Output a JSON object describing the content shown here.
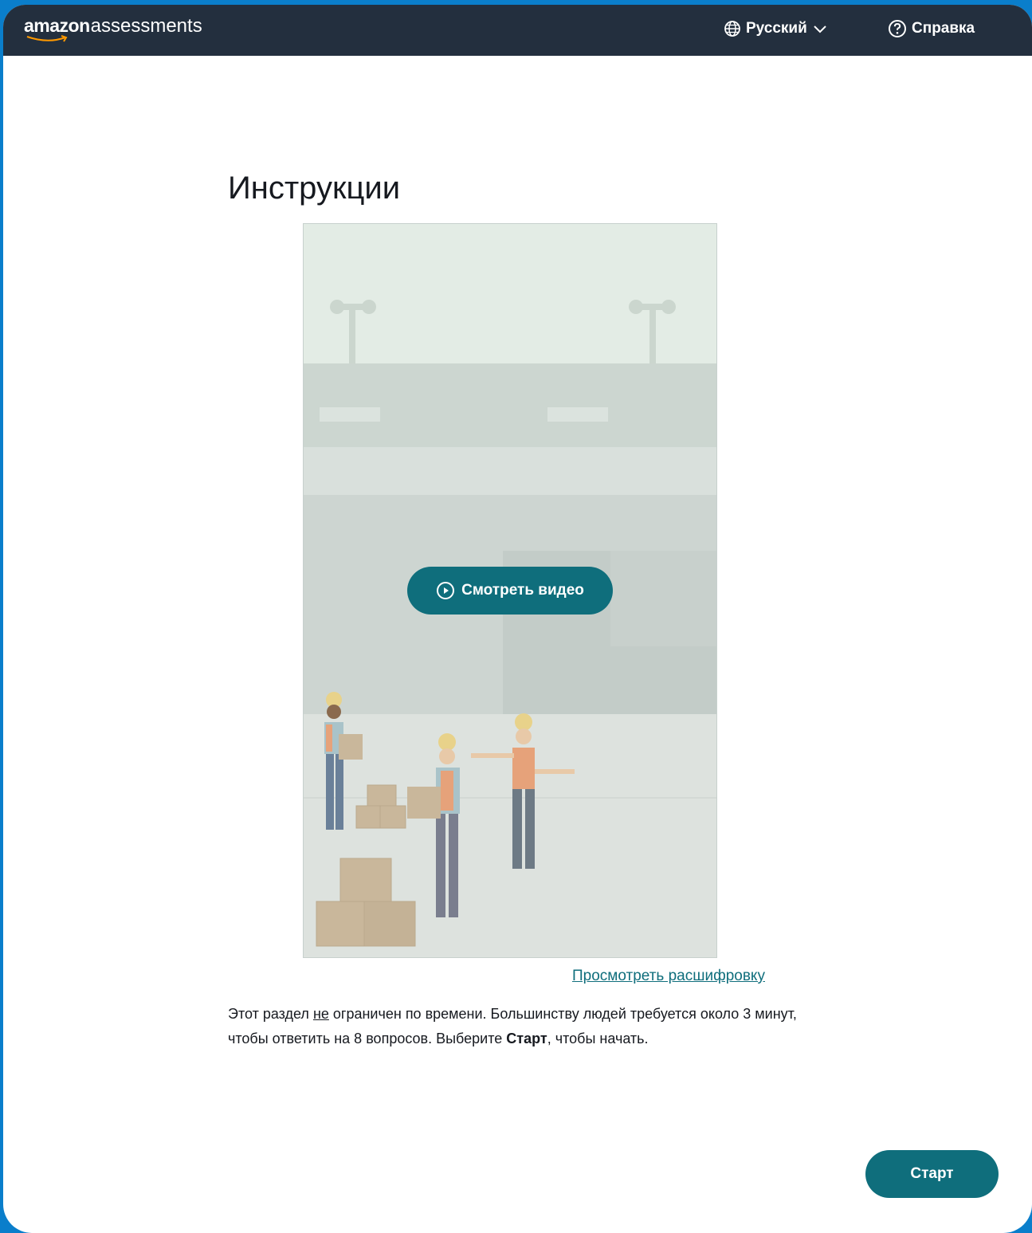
{
  "header": {
    "logo_amazon": "amazon",
    "logo_assessments": "assessments",
    "language_label": "Русский",
    "help_label": "Справка",
    "background_color": "#232f3e"
  },
  "main": {
    "title": "Инструкции",
    "video": {
      "watch_label": "Смотреть видео"
    },
    "transcript_link": "Просмотреть расшифровку",
    "instructions": {
      "part1": "Этот раздел ",
      "emphasis_not": "не",
      "part2": " ограничен по времени. Большинству людей требуется около 3 минут, чтобы ответить на 8 вопросов. Выберите ",
      "bold_start": "Старт",
      "part3": ", чтобы начать."
    },
    "start_button": "Старт"
  },
  "colors": {
    "accent": "#0f6e7c",
    "page_border": "#0a7ecb"
  },
  "icons": [
    "globe-icon",
    "chevron-down-icon",
    "help-circle-icon",
    "play-circle-icon"
  ]
}
